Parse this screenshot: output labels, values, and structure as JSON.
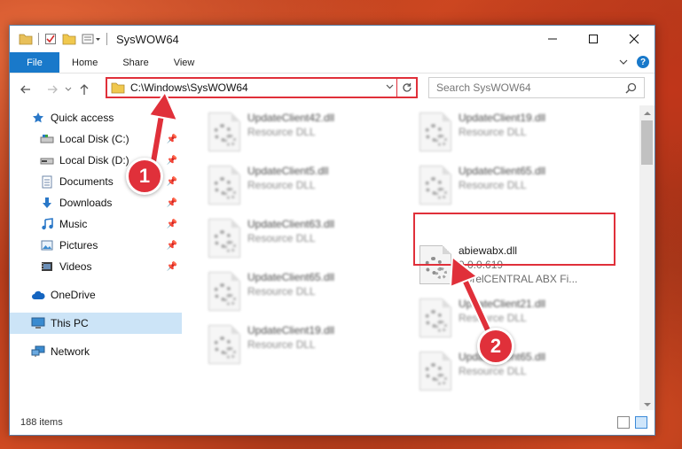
{
  "window": {
    "title": "SysWOW64"
  },
  "ribbon": {
    "tabs": [
      "File",
      "Home",
      "Share",
      "View"
    ],
    "help": "?"
  },
  "address": {
    "path": "C:\\Windows\\SysWOW64"
  },
  "search": {
    "placeholder": "Search SysWOW64"
  },
  "sidebar": {
    "items": [
      {
        "label": "Quick access",
        "icon": "star-icon"
      },
      {
        "label": "Local Disk (C:)",
        "icon": "drive-icon",
        "pinned": true
      },
      {
        "label": "Local Disk (D:)",
        "icon": "drive-icon",
        "pinned": true
      },
      {
        "label": "Documents",
        "icon": "documents-icon",
        "pinned": true
      },
      {
        "label": "Downloads",
        "icon": "download-icon",
        "pinned": true
      },
      {
        "label": "Music",
        "icon": "music-icon",
        "pinned": true
      },
      {
        "label": "Pictures",
        "icon": "pictures-icon",
        "pinned": true
      },
      {
        "label": "Videos",
        "icon": "videos-icon",
        "pinned": true
      },
      {
        "label": "OneDrive",
        "icon": "cloud-icon"
      },
      {
        "label": "This PC",
        "icon": "computer-icon",
        "selected": true
      },
      {
        "label": "Network",
        "icon": "network-icon"
      }
    ]
  },
  "files": [
    {
      "name": "UpdateClient42.dll",
      "sub": "Resource DLL",
      "blurred": true
    },
    {
      "name": "UpdateClient19.dll",
      "sub": "Resource DLL",
      "blurred": true
    },
    {
      "name": "UpdateClient5.dll",
      "sub": "Resource DLL",
      "blurred": true
    },
    {
      "name": "UpdateClient65.dll",
      "sub": "Resource DLL",
      "blurred": true
    },
    {
      "name": "UpdateClient63.dll",
      "sub": "Resource DLL",
      "blurred": true
    },
    {
      "name": "abiewabx.dll",
      "sub": "9.0.0.619",
      "sub2": "CorelCENTRAL ABX Fi...",
      "blurred": false
    },
    {
      "name": "UpdateClient65.dll",
      "sub": "Resource DLL",
      "blurred": true
    },
    {
      "name": "UpdateClient21.dll",
      "sub": "Resource DLL",
      "blurred": true
    },
    {
      "name": "UpdateClient19.dll",
      "sub": "Resource DLL",
      "blurred": true
    },
    {
      "name": "UpdateClient65.dll",
      "sub": "Resource DLL",
      "blurred": true
    }
  ],
  "status": {
    "items": "188 items"
  },
  "annotations": {
    "step1": "1",
    "step2": "2"
  },
  "colors": {
    "accent": "#1979ca",
    "highlight": "#e0303a",
    "selected": "#cce4f7"
  }
}
